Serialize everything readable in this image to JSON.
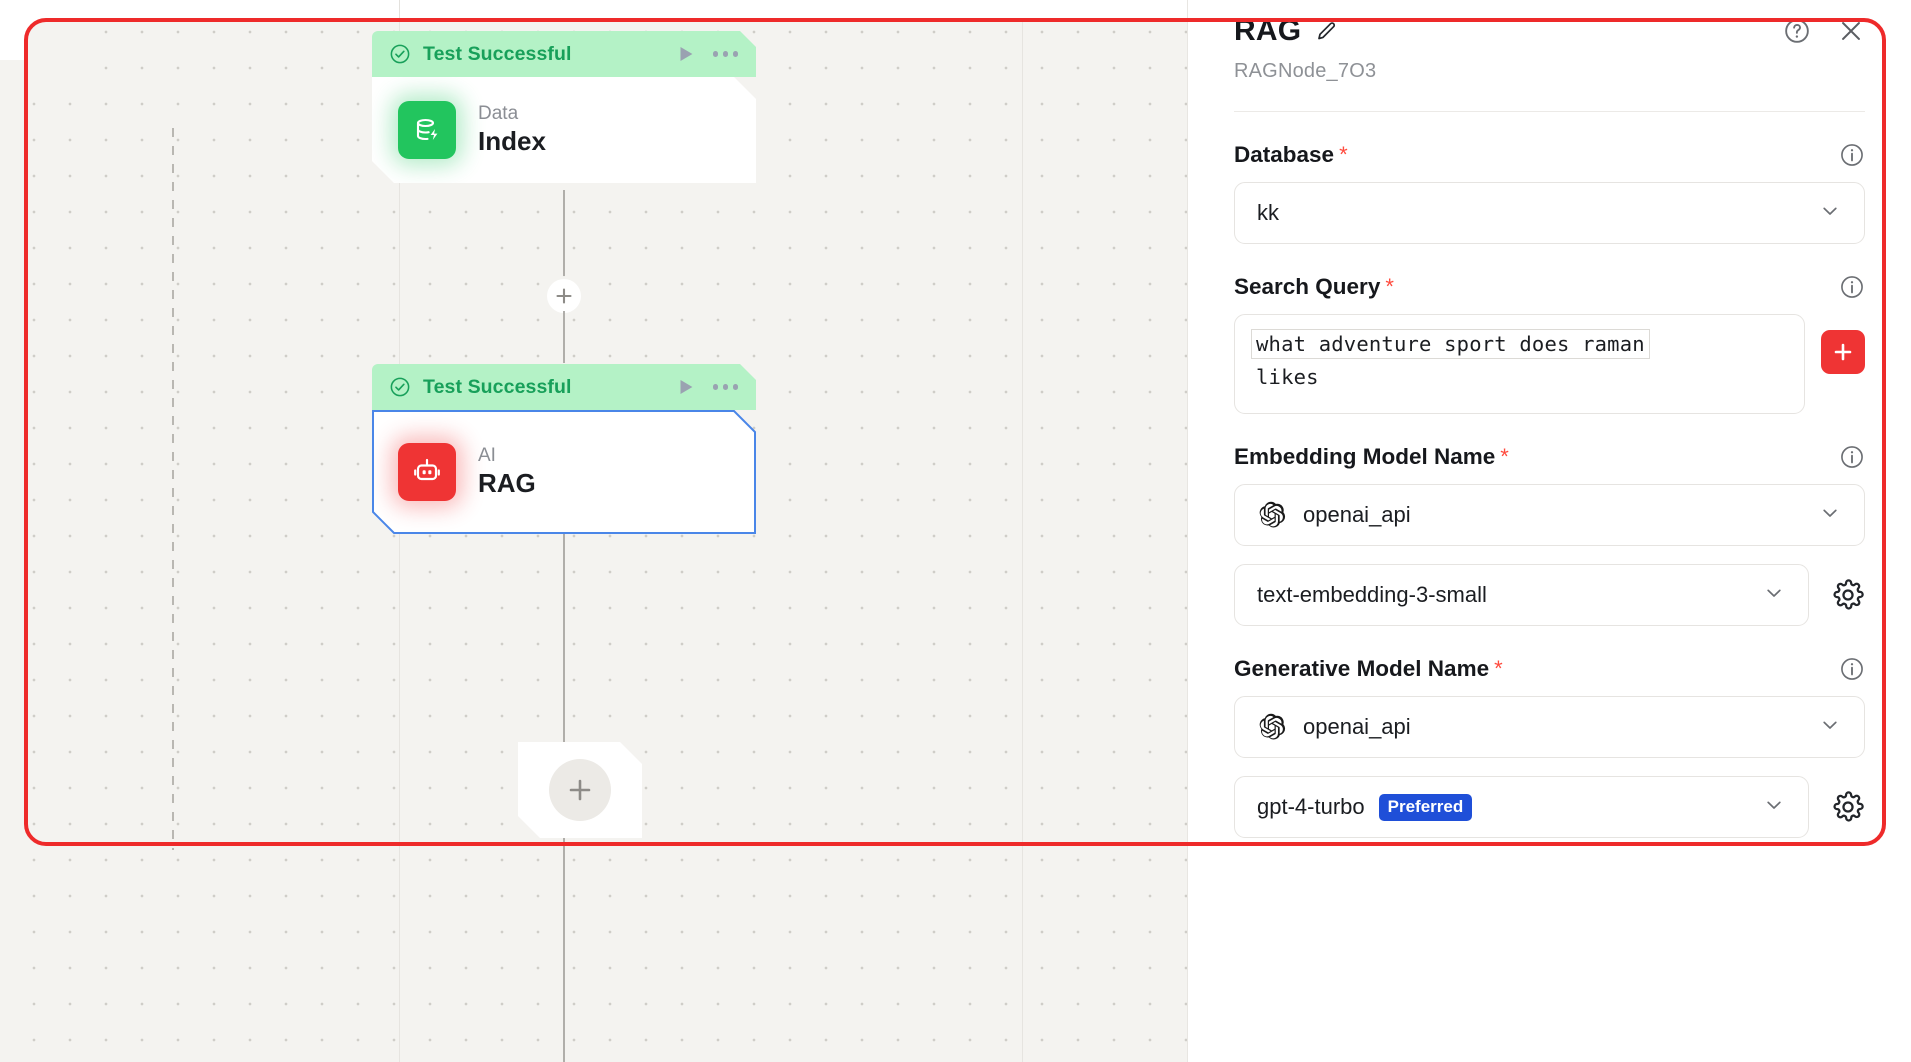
{
  "canvas": {
    "nodes": [
      {
        "status": "Test Successful",
        "kind": "Data",
        "title": "Index",
        "icon": "database-index-icon",
        "accent": "#22c55e"
      },
      {
        "status": "Test Successful",
        "kind": "AI",
        "title": "RAG",
        "icon": "robot-ai-icon",
        "accent": "#ef3434"
      }
    ],
    "add_node_label": "+",
    "inline_add_label": "+"
  },
  "panel": {
    "title": "RAG",
    "subtitle": "RAGNode_7O3",
    "edit_icon": "pencil-icon",
    "help_icon": "help-circle-icon",
    "close_icon": "close-icon",
    "required_marker": "*",
    "fields": {
      "database": {
        "label": "Database",
        "value": "kk",
        "info_icon": "info-icon",
        "chevron_icon": "chevron-down-icon"
      },
      "search_query": {
        "label": "Search Query",
        "value_line_1": "what adventure sport does raman",
        "value_line_2": "likes",
        "add_icon": "plus-icon",
        "info_icon": "info-icon"
      },
      "embedding_model": {
        "label": "Embedding Model Name",
        "provider": "openai_api",
        "provider_icon": "openai-icon",
        "model": "text-embedding-3-small",
        "settings_icon": "gear-icon",
        "info_icon": "info-icon",
        "chevron_icon": "chevron-down-icon"
      },
      "generative_model": {
        "label": "Generative Model Name",
        "provider": "openai_api",
        "provider_icon": "openai-icon",
        "model": "gpt-4-turbo",
        "badge": "Preferred",
        "settings_icon": "gear-icon",
        "info_icon": "info-icon",
        "chevron_icon": "chevron-down-icon"
      }
    }
  },
  "colors": {
    "annotation": "#ee2a2a",
    "success": "#18a05a",
    "success_bg": "#b4f2c6",
    "badge_blue": "#1f4fd8",
    "accent_red": "#ef3434",
    "selection_blue": "#4a86e8"
  }
}
